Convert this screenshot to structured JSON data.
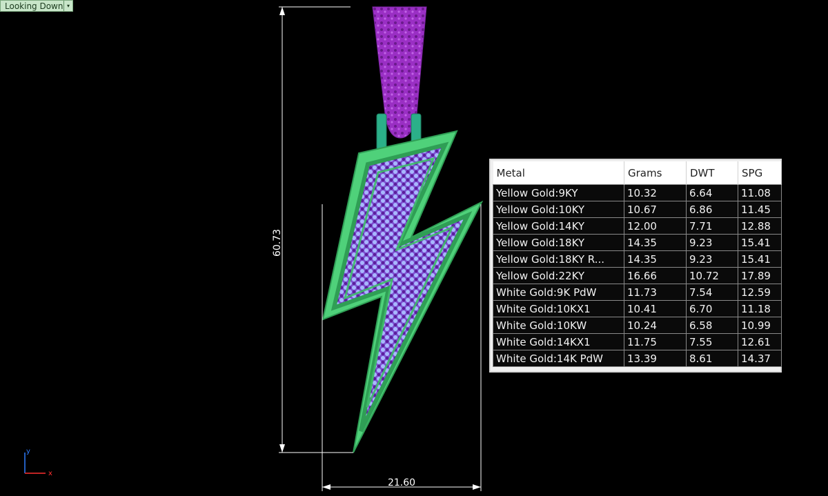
{
  "viewport": {
    "view_name": "Looking Down",
    "view_dropdown": "▾",
    "height_dimension": "60.73",
    "width_dimension": "21.60",
    "axis": {
      "y": "y",
      "x": "x"
    }
  },
  "metal_table": {
    "headers": [
      "Metal",
      "Grams",
      "DWT",
      "SPG"
    ],
    "rows": [
      [
        "Yellow Gold:9KY",
        "10.32",
        "6.64",
        "11.08"
      ],
      [
        "Yellow Gold:10KY",
        "10.67",
        "6.86",
        "11.45"
      ],
      [
        "Yellow Gold:14KY",
        "12.00",
        "7.71",
        "12.88"
      ],
      [
        "Yellow Gold:18KY",
        "14.35",
        "9.23",
        "15.41"
      ],
      [
        "Yellow Gold:18KY R...",
        "14.35",
        "9.23",
        "15.41"
      ],
      [
        "Yellow Gold:22KY",
        "16.66",
        "10.72",
        "17.89"
      ],
      [
        "White Gold:9K PdW",
        "11.73",
        "7.54",
        "12.59"
      ],
      [
        "White Gold:10KX1",
        "10.41",
        "6.70",
        "11.18"
      ],
      [
        "White Gold:10KW",
        "10.24",
        "6.58",
        "10.99"
      ],
      [
        "White Gold:14KX1",
        "11.75",
        "7.55",
        "12.61"
      ],
      [
        "White Gold:14K PdW",
        "13.39",
        "8.61",
        "14.37"
      ]
    ]
  },
  "colors": {
    "background": "#000000",
    "bail": "#9a2fc4",
    "frame": "#4fd17a",
    "stones_light": "#9fb0ff",
    "stones_dark": "#6a2db0"
  }
}
